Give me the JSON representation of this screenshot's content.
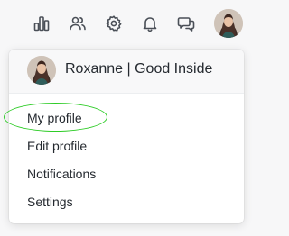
{
  "topbar": {
    "icons": [
      "stats-icon",
      "people-icon",
      "gear-icon",
      "bell-icon",
      "chat-icon"
    ]
  },
  "user": {
    "display_name": "Roxanne | Good Inside"
  },
  "menu": {
    "items": [
      {
        "label": "My profile"
      },
      {
        "label": "Edit profile"
      },
      {
        "label": "Notifications"
      },
      {
        "label": "Settings"
      }
    ]
  },
  "colors": {
    "highlight": "#2ecc27",
    "icon": "#4a4f57"
  }
}
